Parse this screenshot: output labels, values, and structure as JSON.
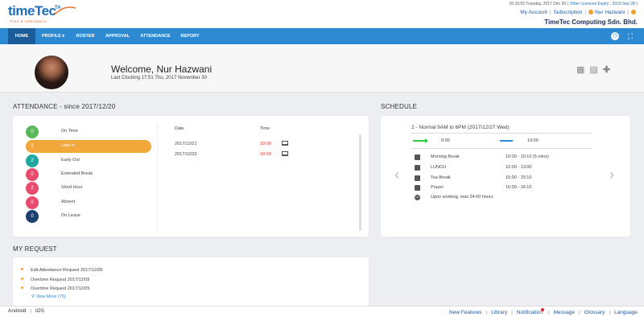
{
  "header": {
    "logo_text": "timeTec",
    "logo_ta": "TA",
    "logo_sub": "Time & Attendance",
    "datetime": "16:16:55 Tuesday, 2017 Dec 26",
    "licence": "Other Licences Expiry : 2019 Sep 28",
    "links": {
      "my_account": "My Account",
      "subscription": "Subscription",
      "user": "Nur Hazwani"
    },
    "company": "TimeTec Computing Sdn. Bhd."
  },
  "nav": {
    "items": [
      "HOME",
      "PROFILE ▾",
      "ROSTER",
      "APPROVAL",
      "ATTENDANCE",
      "REPORT"
    ]
  },
  "welcome": {
    "title": "Welcome, Nur Hazwani",
    "last_clocking": "Last Clocking 17:51 Thu, 2017 November 30"
  },
  "attendance": {
    "title": "ATTENDANCE - since 2017/12/20",
    "summary": [
      {
        "count": "0",
        "label": "On Time",
        "color": "#5cb85c"
      },
      {
        "count": "2",
        "label": "Late In",
        "color": "#f2a73b"
      },
      {
        "count": "2",
        "label": "Early Out",
        "color": "#1fa8a0"
      },
      {
        "count": "0",
        "label": "Extended Break",
        "color": "#e74c6c"
      },
      {
        "count": "2",
        "label": "Short Hour",
        "color": "#e74c6c"
      },
      {
        "count": "0",
        "label": "Absent",
        "color": "#e74c6c"
      },
      {
        "count": "0",
        "label": "On Leave",
        "color": "#1b3f6e"
      }
    ],
    "table_headers": {
      "date": "Date",
      "time": "Time"
    },
    "rows": [
      {
        "date": "2017/12/21",
        "time": "10:00"
      },
      {
        "date": "2017/12/20",
        "time": "10:00"
      }
    ]
  },
  "schedule": {
    "title": "SCHEDULE",
    "shift": "2 - Normal 9AM to 6PM (2017/12/27 Wed)",
    "in_time": "9:00",
    "out_time": "19:00",
    "breaks": [
      {
        "name": "Morning Break",
        "time": "10:00 - 10:10 (5 mins)"
      },
      {
        "name": "LUNCH",
        "time": "12:00 - 13:00"
      },
      {
        "name": "Tea Break",
        "time": "15:00 - 15:10"
      },
      {
        "name": "Prayer",
        "time": "16:00 - 16:10"
      }
    ],
    "ot_note": "Upon working, max 24:00 hours",
    "ot_badge": "OT"
  },
  "requests": {
    "title": "MY REQUEST",
    "items": [
      "Edit Attendance Request 2017/12/05",
      "Overtime Request 2017/12/05",
      "Overtime Request 2017/12/05"
    ],
    "view_more": "View More (75)"
  },
  "footer": {
    "left": [
      "Android",
      "iOS"
    ],
    "right": [
      "New Features",
      "Library",
      "Notification",
      "Message",
      "Glossary",
      "Language"
    ]
  }
}
